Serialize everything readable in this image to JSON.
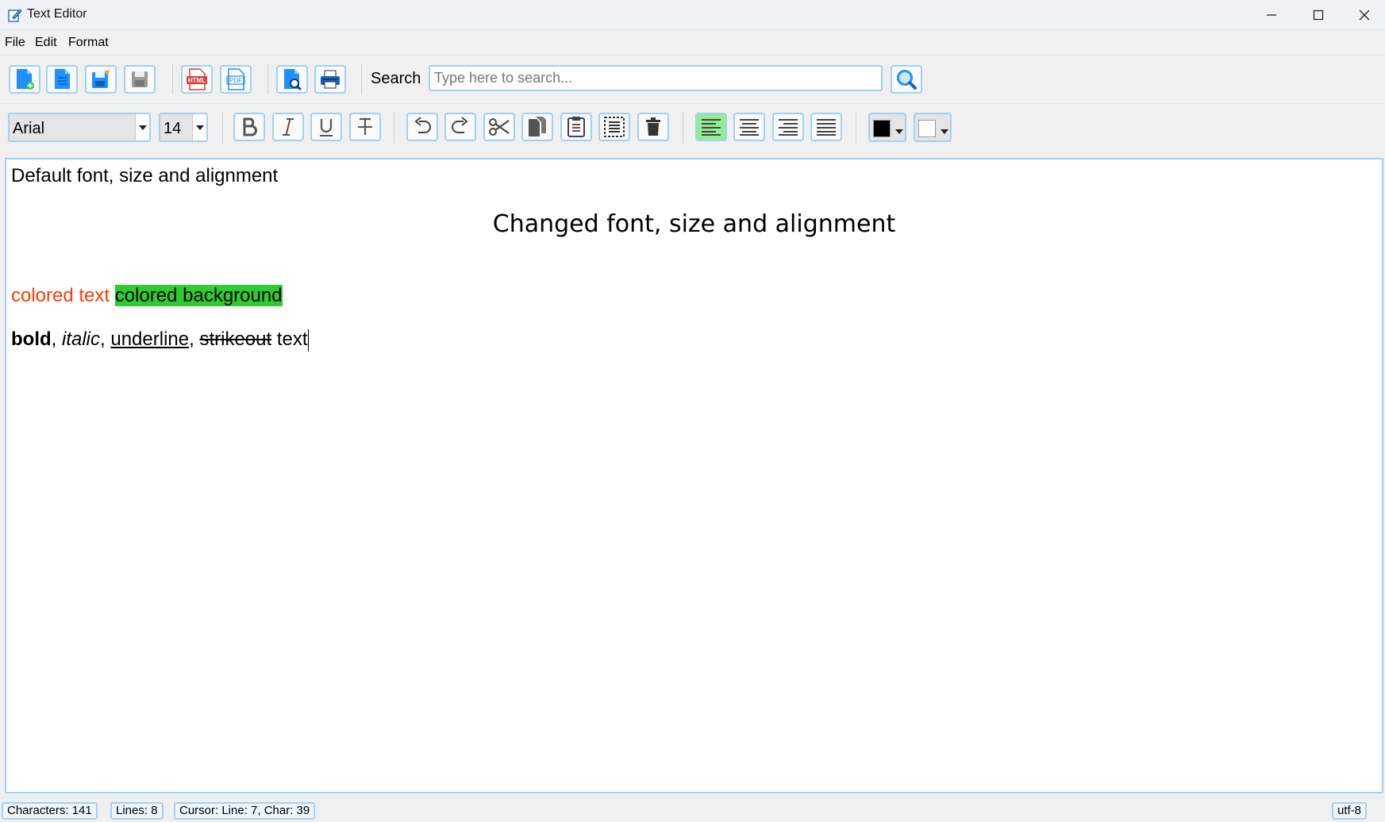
{
  "window": {
    "title": "Text Editor",
    "app_icon": "notepad-icon"
  },
  "menu": {
    "file": "File",
    "edit": "Edit",
    "format": "Format"
  },
  "toolbar1": {
    "buttons": [
      "new-file-icon",
      "open-file-icon",
      "save-as-icon",
      "save-icon",
      "export-html-icon",
      "export-pdf-icon",
      "print-preview-icon",
      "print-icon"
    ],
    "export_html_label": "HTML",
    "export_pdf_label": "PDF",
    "search_label": "Search",
    "search_placeholder": "Type here to search...",
    "search_value": ""
  },
  "toolbar2": {
    "font_family": "Arial",
    "font_size": "14",
    "text_color": "#000000",
    "background_color": "#ffffff",
    "active_alignment": "left"
  },
  "editor": {
    "line1": "Default font, size and alignment",
    "line2": "Changed font, size and alignment",
    "colored_text": "colored text",
    "colored_background": "colored background",
    "bold": "bold",
    "sep1": ", ",
    "italic": "italic",
    "sep2": ", ",
    "underline": "underline",
    "sep3": ", ",
    "strikeout": "strikeout",
    "tail": " text",
    "colored_text_color": "#ff3b00",
    "colored_background_color": "#2ecc2e"
  },
  "status": {
    "characters": "Characters: 141",
    "lines": "Lines: 8",
    "cursor": "Cursor: Line: 7, Char: 39",
    "encoding": "utf-8"
  }
}
